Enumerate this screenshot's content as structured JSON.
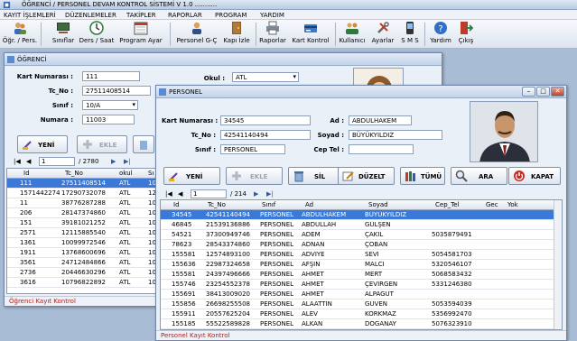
{
  "app": {
    "title": "ÖĞRENCİ / PERSONEL DEVAM KONTROL SİSTEMİ  V 1.0 ..........."
  },
  "menu": [
    "KAYIT İŞLEMLERİ",
    "DÜZENLEMELER",
    "TAKİPLER",
    "RAPORLAR",
    "PROGRAM",
    "YARDIM"
  ],
  "toolbar": [
    {
      "label": "Öğr. / Pers.",
      "icon": "people-icon"
    },
    {
      "label": "Sınıflar",
      "icon": "classroom-icon"
    },
    {
      "label": "Ders / Saat",
      "icon": "clock-icon"
    },
    {
      "label": "Program Ayar",
      "icon": "calendar-icon"
    },
    {
      "label": "Personel G-Ç",
      "icon": "person-icon"
    },
    {
      "label": "Kapı İzle",
      "icon": "door-icon"
    },
    {
      "label": "Raporlar",
      "icon": "printer-icon"
    },
    {
      "label": "Kart Kontrol",
      "icon": "card-icon"
    },
    {
      "label": "Kullanıcı",
      "icon": "users-icon"
    },
    {
      "label": "Ayarlar",
      "icon": "tools-icon"
    },
    {
      "label": "S M S",
      "icon": "sms-icon"
    },
    {
      "label": "Yardım",
      "icon": "help-icon"
    },
    {
      "label": "Çıkış",
      "icon": "exit-icon"
    }
  ],
  "ogrenci": {
    "title": "ÖĞRENCİ",
    "kart_label": "Kart Numarası :",
    "kart": "111",
    "tc_label": "Tc_No :",
    "tc": "27511408514",
    "sinif_label": "Sınıf :",
    "sinif": "10/A",
    "numara_label": "Numara :",
    "numara": "11003",
    "okul_label": "Okul :",
    "okul": "ATL",
    "btn_yeni": "YENİ",
    "btn_ekle": "EKLE",
    "nav_page": "1",
    "nav_total": "/ 2780",
    "columns": [
      "Id",
      "Tc_No",
      "okul",
      "Sı"
    ],
    "rows": [
      [
        "111",
        "27511408514",
        "ATL",
        "10"
      ],
      [
        "1571442274",
        "17290732078",
        "ATL",
        "12"
      ],
      [
        "11",
        "38776287288",
        "ATL",
        "10"
      ],
      [
        "206",
        "28147374860",
        "ATL",
        "10"
      ],
      [
        "151",
        "39181021252",
        "ATL",
        "10"
      ],
      [
        "2571",
        "12115885540",
        "ATL",
        "10"
      ],
      [
        "1361",
        "10099972546",
        "ATL",
        "10"
      ],
      [
        "1911",
        "13768600696",
        "ATL",
        "10"
      ],
      [
        "3561",
        "24712484866",
        "ATL",
        "10"
      ],
      [
        "2736",
        "20446630296",
        "ATL",
        "10"
      ],
      [
        "3616",
        "10796822892",
        "ATL",
        "10"
      ]
    ],
    "status": "Öğrenci Kayıt Kontrol"
  },
  "personel": {
    "title": "PERSONEL",
    "kart_label": "Kart Numarası :",
    "kart": "34545",
    "tc_label": "Tc_No :",
    "tc": "42541140494",
    "sinif_label": "Sınıf :",
    "sinif": "PERSONEL",
    "ad_label": "Ad :",
    "ad": "ABDULHAKEM",
    "soyad_label": "Soyad :",
    "soyad": "BÜYÜKYILDIZ",
    "ceptel_label": "Cep Tel :",
    "ceptel": "",
    "buttons": {
      "yeni": "YENİ",
      "ekle": "EKLE",
      "sil": "SİL",
      "duzelt": "DÜZELT",
      "tumu": "TÜMÜ",
      "ara": "ARA",
      "kapat": "KAPAT"
    },
    "nav_page": "1",
    "nav_total": "/ 214",
    "columns": [
      "Id",
      "Tc_No",
      "Sınıf",
      "Ad",
      "Soyad",
      "Cep_Tel",
      "Gec",
      "Yok"
    ],
    "rows": [
      [
        "34545",
        "42541140494",
        "PERSONEL",
        "ABDULHAKEM",
        "BÜYÜKYILDIZ",
        "",
        "",
        ""
      ],
      [
        "46845",
        "21539136886",
        "PERSONEL",
        "ABDULLAH",
        "GÜLŞEN",
        "",
        "",
        ""
      ],
      [
        "54521",
        "37300949746",
        "PERSONEL",
        "ADEM",
        "ÇAKIL",
        "5035879491",
        "",
        ""
      ],
      [
        "78623",
        "28543374860",
        "PERSONEL",
        "ADNAN",
        "ÇOBAN",
        "",
        "",
        ""
      ],
      [
        "155581",
        "12574893100",
        "PERSONEL",
        "ADVİYE",
        "SEVİ",
        "5054581703",
        "",
        ""
      ],
      [
        "155636",
        "22987324658",
        "PERSONEL",
        "AFŞİN",
        "MALCI",
        "5320546107",
        "",
        ""
      ],
      [
        "155581",
        "24397496666",
        "PERSONEL",
        "AHMET",
        "MERT",
        "5068583432",
        "",
        ""
      ],
      [
        "155746",
        "23254552378",
        "PERSONEL",
        "AHMET",
        "ÇEVİRGEN",
        "5331246380",
        "",
        ""
      ],
      [
        "155691",
        "38413009020",
        "PERSONEL",
        "AHMET",
        "ALPAĞUT",
        "",
        "",
        ""
      ],
      [
        "155856",
        "26698255508",
        "PERSONEL",
        "ALAATTİN",
        "GÜVEN",
        "5053594039",
        "",
        ""
      ],
      [
        "155911",
        "20557625204",
        "PERSONEL",
        "ALEV",
        "KORKMAZ",
        "5356992470",
        "",
        ""
      ],
      [
        "155185",
        "55522589828",
        "PERSONEL",
        "ALKAN",
        "DOĞANAY",
        "5076323910",
        "",
        ""
      ]
    ],
    "status": "Personel Kayıt Kontrol"
  },
  "colors": {
    "selected_row": "#3a79d8",
    "status_text": "#b0201a",
    "desktop": "#a9bcd5"
  }
}
